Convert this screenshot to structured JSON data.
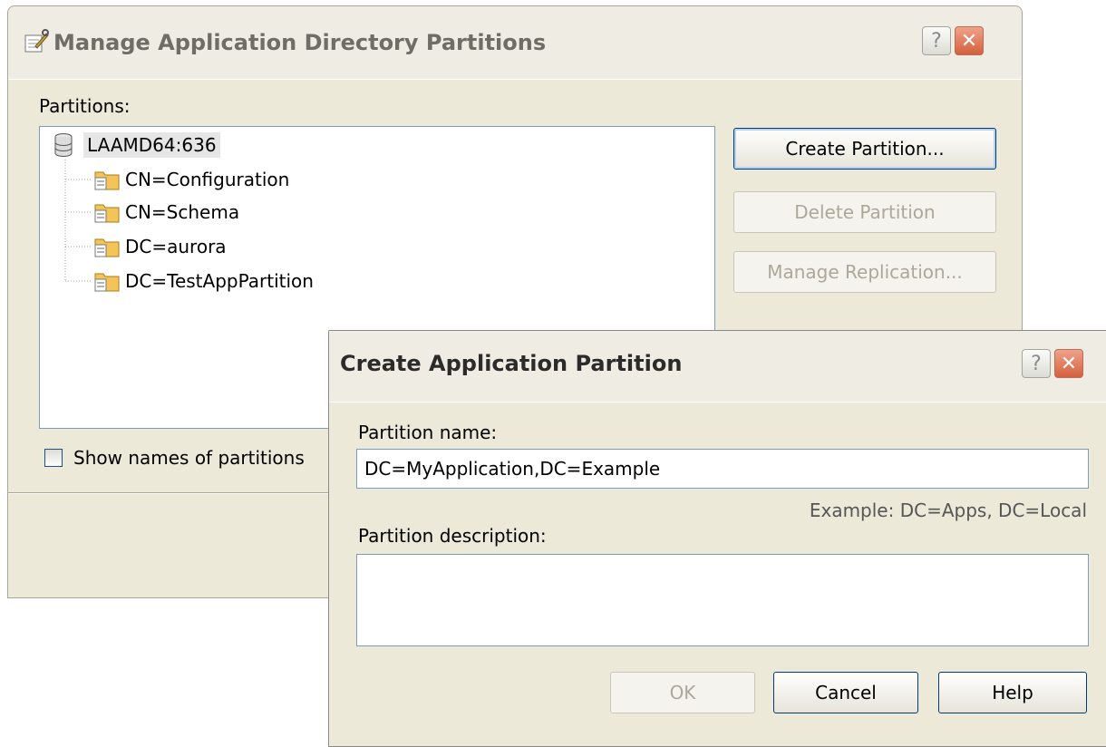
{
  "manage_dialog": {
    "title": "Manage Application Directory Partitions",
    "title_icon": "wrench-properties-icon",
    "partitions_label": "Partitions:",
    "tree": {
      "root": "LAAMD64:636",
      "root_icon": "database-icon",
      "children": [
        "CN=Configuration",
        "CN=Schema",
        "DC=aurora",
        "DC=TestAppPartition"
      ],
      "child_icon": "folder-icon"
    },
    "buttons": {
      "create": "Create Partition...",
      "delete": "Delete Partition",
      "manage_replication": "Manage Replication..."
    },
    "show_names_label": "Show names of partitions",
    "show_names_checked": false
  },
  "create_dialog": {
    "title": "Create Application Partition",
    "partition_name_label": "Partition name:",
    "partition_name_value": "DC=MyApplication,DC=Example",
    "example_hint": "Example: DC=Apps, DC=Local",
    "description_label": "Partition description:",
    "description_value": "",
    "buttons": {
      "ok": "OK",
      "cancel": "Cancel",
      "help": "Help"
    }
  },
  "titlebar_buttons": {
    "help": "?",
    "close": "✕"
  },
  "colors": {
    "dialog_bg": "#ece9d8",
    "close_button": "#d4603c",
    "tree_border": "#7f9db9",
    "default_button_border": "#003c74"
  }
}
